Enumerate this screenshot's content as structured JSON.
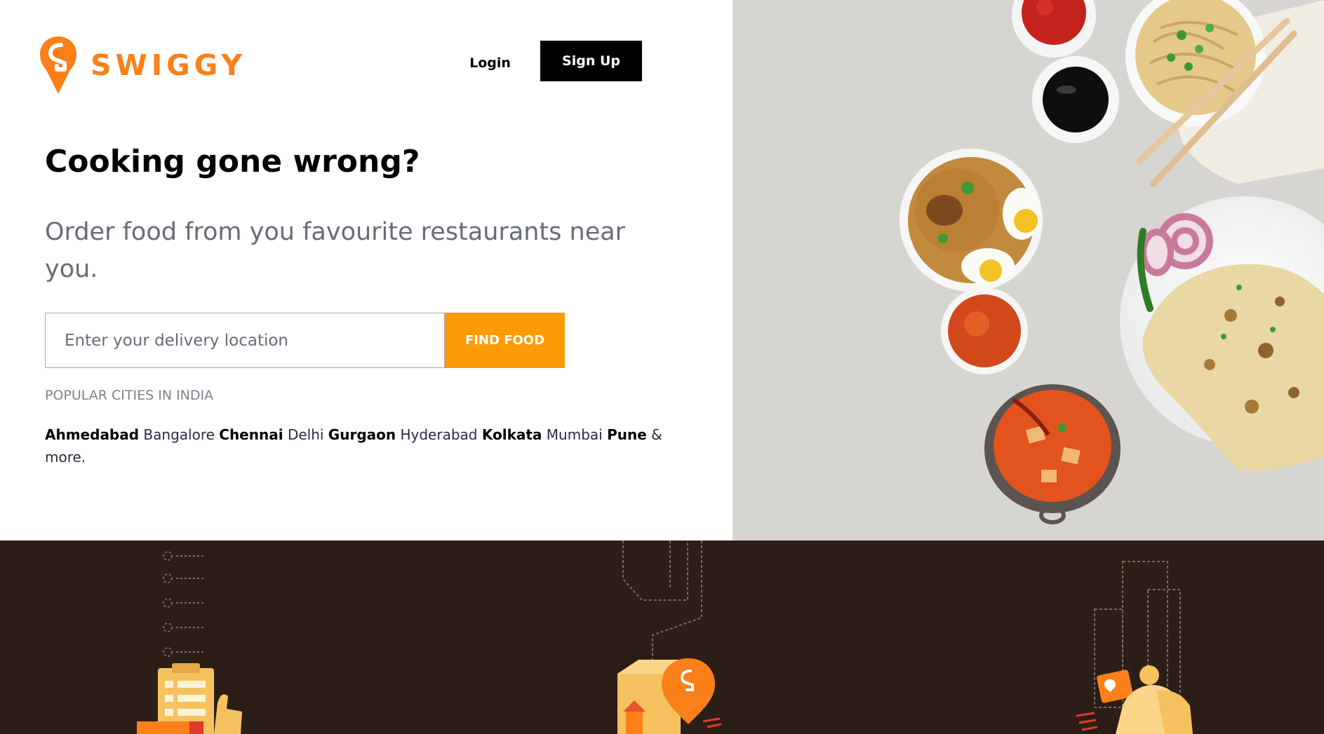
{
  "brand": {
    "name": "SWIGGY",
    "color": "#fc8019"
  },
  "header": {
    "login_label": "Login",
    "signup_label": "Sign Up"
  },
  "hero": {
    "title": "Cooking gone wrong?",
    "subtitle": "Order food from you favourite restaurants near you."
  },
  "search": {
    "placeholder": "Enter your delivery location",
    "value": "",
    "button_label": "FIND FOOD",
    "button_color": "#fc9b08"
  },
  "popular": {
    "heading": "POPULAR CITIES IN INDIA",
    "cities": [
      {
        "name": "Ahmedabad",
        "bold": true
      },
      {
        "name": "Bangalore",
        "bold": false
      },
      {
        "name": "Chennai",
        "bold": true
      },
      {
        "name": "Delhi",
        "bold": false
      },
      {
        "name": "Gurgaon",
        "bold": true
      },
      {
        "name": "Hyderabad",
        "bold": false
      },
      {
        "name": "Kolkata",
        "bold": true
      },
      {
        "name": "Mumbai",
        "bold": false
      },
      {
        "name": "Pune",
        "bold": true
      }
    ],
    "more_label": "& more."
  },
  "hero_image": {
    "icon": "food-spread-image"
  },
  "features": {
    "background": "#2b1e16",
    "illustrations": [
      "order-list-icon",
      "location-pin-icon",
      "delivery-scooter-icon"
    ]
  }
}
